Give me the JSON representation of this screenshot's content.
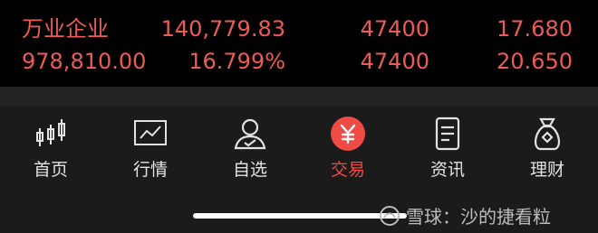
{
  "holdings": {
    "rows": [
      {
        "name": "万业企业",
        "value": "140,779.83",
        "qty": "47400",
        "price": "17.680"
      },
      {
        "name": "978,810.00",
        "value": "16.799%",
        "qty": "47400",
        "price": "20.650"
      }
    ],
    "color": "#ec5b56"
  },
  "tabbar": {
    "tabs": [
      {
        "label": "首页",
        "icon": "candlestick-icon"
      },
      {
        "label": "行情",
        "icon": "line-chart-icon"
      },
      {
        "label": "自选",
        "icon": "person-icon"
      },
      {
        "label": "交易",
        "icon": "yuan-circle-icon"
      },
      {
        "label": "资讯",
        "icon": "document-icon"
      },
      {
        "label": "理财",
        "icon": "money-bag-icon"
      }
    ],
    "active": "交易",
    "active_color": "#ef4b44"
  },
  "watermark": {
    "text": "雪球：沙的捷看粒"
  }
}
